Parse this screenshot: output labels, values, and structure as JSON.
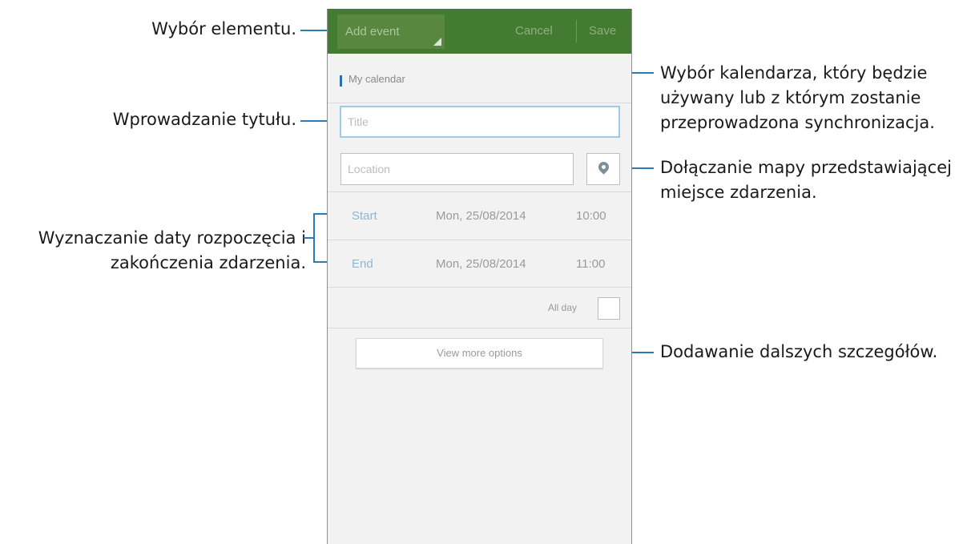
{
  "annotations": {
    "select_item": "Wybór elementu.",
    "select_calendar": [
      "Wybór kalendarza, który będzie",
      "używany lub z którym zostanie",
      "przeprowadzona synchronizacja."
    ],
    "enter_title": "Wprowadzanie tytułu.",
    "attach_map": [
      "Dołączanie mapy przedstawiającej",
      "miejsce zdarzenia."
    ],
    "set_dates": [
      "Wyznaczanie daty rozpoczęcia i",
      "zakończenia zdarzenia."
    ],
    "more_details": "Dodawanie dalszych szczegółów."
  },
  "screen": {
    "actionbar": {
      "selector_label": "Add event",
      "cancel_label": "Cancel",
      "save_label": "Save",
      "color": "#447b33"
    },
    "calendar": {
      "label": "My calendar"
    },
    "title_field": {
      "placeholder": "Title"
    },
    "location_field": {
      "placeholder": "Location"
    },
    "map_icon": "map-pin-icon",
    "start": {
      "label": "Start",
      "date": "Mon, 25/08/2014",
      "time": "10:00"
    },
    "end": {
      "label": "End",
      "date": "Mon, 25/08/2014",
      "time": "11:00"
    },
    "all_day": {
      "label": "All day",
      "checked": false
    },
    "more_options_label": "View more options"
  }
}
